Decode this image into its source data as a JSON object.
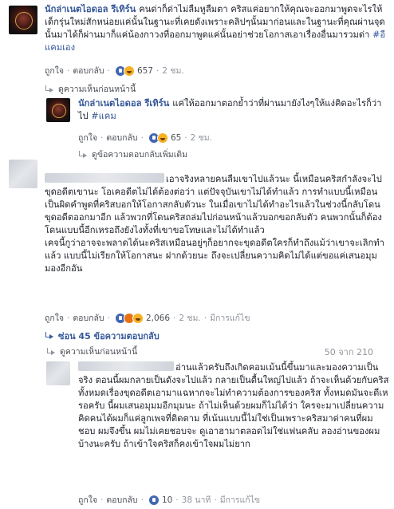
{
  "comments": [
    {
      "author": "นักล่าเนตไอดอล รีเทิร์น",
      "text": "คนด่าก็ด่าไม่ลืมหูลืมตา คริสแค่อยากให้คุณจะออกมาพูดจะไรให้เด็กรุ่นใหม่สักหน่อยแค่นั้นในฐานะที่เคยดังเพราะคลิปๆนั้นมาก่อนและในฐานะที่คุณผ่านจุดนั้นมาได้ก็ผ่านมาก็แค่น้องกาวงที่ออกมาพูดแค่นั้นอย่าช่วยโอกาสเอาเรื่องอื่นมารวมด่า ",
      "hashtag": "#อีแคมเอง",
      "like_label": "ถูกใจ",
      "reply_label": "ตอบกลับ",
      "reaction_count": "657",
      "time": "2 ชม."
    },
    {
      "author": "นักล่าเนตไอดอล รีเทิร์น",
      "text": "แค่ให้ออกมาตอกย้ำว่าที่ผ่านมายังไงๆให้แง่คิดอะไรก็ว่าไป ",
      "hashtag": "#แคม",
      "like_label": "ถูกใจ",
      "reply_label": "ตอบกลับ",
      "reaction_count": "65",
      "time": "2 ชม."
    },
    {
      "text": "เอาจริงหลายคนลืมเขาไปแล้วนะ นี้เหมือนคริสกำลังจะไปขุดอดีตเขานะ โอเคอดีตไม่ได้ต้องต่อว่า แต่ปัจจุบันเขาไม่ได้ทำแล้ว การทำแบบนี้เหมือนเป็นผิดคำพูดที่คริสบอกให้โอกาสกลับตัวนะ ในเมื่อเขาไม่ได้ทำอะไรแล้วในช่วงนี้กลับโดนขุดอดีตออกมาอีก แล้วพวกที่โดนคริสถล่มไปก่อนหน้าแล้วบอกขอกลับตัว คนพวกนั้นก็ต้องโดนแบบนี้อีกเหรอถึงยังไงทั้งที่เขาขอโทษและไม่ได้ทำแล้ว\nเคจนี้กูว่าอาจจะพลาดได้นะคริสเหมือนอยู่ๆก็อยากจะขุดอดีตใครก็ทำถึงแม้ว่าเขาจะเลิกทำแล้ว แบบนี้ไม่เรียกให้โอกาสนะ ฝากด้วยนะ ถึงจะเปลี่ยนความคิดไม่ได้แต่ขอแค่เสนอมุมมองอีกอัน",
      "like_label": "ถูกใจ",
      "reply_label": "ตอบกลับ",
      "reaction_count": "2,066",
      "time": "2 ชม.",
      "edited_label": "มีการแก้ไข"
    },
    {
      "text": "อ่านแล้วครับถึงเกิดคอมเม้นนี้ขึ้นมาและมองความเป็นจริง ตอนนี้ผมกลายเป็นดังจะไปแล้ว กลายเป็นดื้นใหญ่ไปแล้ว ถ้าจะเห็นด้วยกับคริสทั้งหมดเรื่องขุดอดีตเอามาแฉหากจะไม่ทำความต้องการของคริส ทั้งหมดมันจะดีเหรอครับ นี้ผมเสนอมุมมอีกมุมนะ ถ้าไม่เห็นด้วยผมก็ไม่ได้ว่า ใครจะมาเปลี่ยนความคิดคนได้ผมก็แค่ลูกเพจที่ติดตาม ที่เน้นแบบนี้ไม่ใช่เป็นเพราะคริสมาด่าคนที่ผมชอบ ผมจึงขึ้น ผมไม่เคยชอบจะ ดูเอาฮามาตลอดไม่ใช่แฟนคลับ ลองอ่านของผมบ้างนะครับ ถ้าเข้าใจคริสก็คงเข้าใจผมไม่ยาก",
      "like_label": "ถูกใจ",
      "reply_label": "ตอบกลับ",
      "reaction_count": "10",
      "time": "38 นาที",
      "edited_label": "มีการแก้ไข"
    }
  ],
  "links": {
    "view_previous_1": "ดูความเห็นก่อนหน้านี้",
    "more_replies": "ดูข้อความตอบกลับเพิ่มเติม",
    "hide_replies": "ซ่อน 45 ข้อความตอบกลับ",
    "view_previous_2": "ดูความเห็นก่อนหน้านี้"
  },
  "pagination": "50 จาก 210",
  "colors": {
    "link": "#365899",
    "meta": "#90949c",
    "like": "#4267b2",
    "haha": "#f7b125",
    "angry": "#e9710f"
  },
  "icons": [
    "page-logo-avatar",
    "blurred-user-avatar",
    "like-reaction-icon",
    "haha-reaction-icon",
    "angry-reaction-icon",
    "reply-arrow-icon"
  ]
}
